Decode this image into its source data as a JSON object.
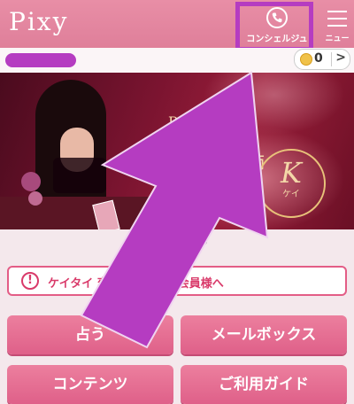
{
  "header": {
    "logo": "Pixy",
    "concierge_label": "コンシェルジュ",
    "menu_label": "ニュー"
  },
  "points": {
    "value": "0",
    "chevron": ">"
  },
  "banner": {
    "tagline": "Pix      率1位",
    "name": "ソ                 師",
    "k_letter": "K",
    "k_reading": "ケイ"
  },
  "carousel": {
    "active_index": 1,
    "count": 2
  },
  "notice": {
    "icon": "!",
    "text": "ケイタイ           変更をご検討の会員様へ"
  },
  "buttons": {
    "fortune": "占う",
    "mailbox": "メールボックス",
    "contents": "コンテンツ",
    "guide": "ご利用ガイド"
  },
  "colors": {
    "header": "#e28aa3",
    "accent": "#df6089",
    "highlight": "#b53cc1"
  }
}
